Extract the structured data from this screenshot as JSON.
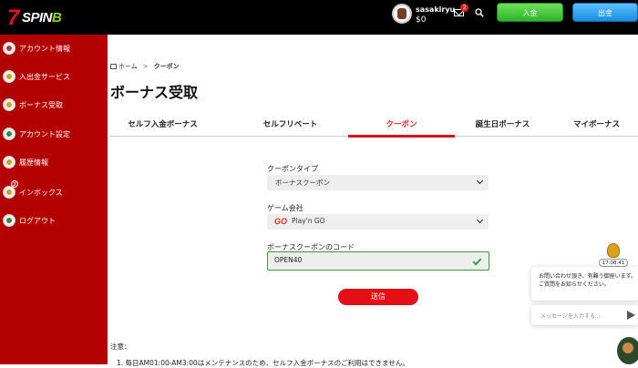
{
  "header": {
    "logo_seven": "7",
    "logo_spin": "SPIN",
    "logo_b": "B",
    "username": "sasakiryu",
    "balance": "$0",
    "mail_badge": "2",
    "deposit_label": "入金",
    "withdraw_label": "出金"
  },
  "sidebar": {
    "items": [
      {
        "label": "アカウント情報",
        "icon": "account-icon",
        "color": "#c0392b"
      },
      {
        "label": "入出金サービス",
        "icon": "wallet-icon",
        "color": "#d4a017"
      },
      {
        "label": "ボーナス受取",
        "icon": "bonus-icon",
        "color": "#d4a017"
      },
      {
        "label": "アカウント設定",
        "icon": "gear-icon",
        "color": "#3a8a3a"
      },
      {
        "label": "履歴情報",
        "icon": "history-icon",
        "color": "#d4a017"
      },
      {
        "label": "インボックス",
        "icon": "inbox-icon",
        "color": "#d4a017",
        "badge": "2"
      },
      {
        "label": "ログアウト",
        "icon": "logout-icon",
        "color": "#3a8a3a"
      }
    ]
  },
  "breadcrumb": {
    "home": "ホーム",
    "separator": ">",
    "current": "クーポン"
  },
  "page_title": "ボーナス受取",
  "tabs": [
    {
      "label": "セルフ入金ボーナス",
      "active": false
    },
    {
      "label": "セルフリベート",
      "active": false
    },
    {
      "label": "クーポン",
      "active": true
    },
    {
      "label": "誕生日ボーナス",
      "active": false
    },
    {
      "label": "マイボーナス",
      "active": false
    }
  ],
  "form": {
    "coupon_type_label": "クーポンタイプ",
    "coupon_type_value": "ボーナスクーポン",
    "game_company_label": "ゲーム会社",
    "game_company_logo": "GO",
    "game_company_value": "Play'n GO",
    "code_label": "ボーナスクーポンのコード",
    "code_value": "OPEN40",
    "submit_label": "送信"
  },
  "notes": {
    "title": "注意：",
    "line1": "1. 毎日AM01:00-AM3:00はメンテナンスのため、セルフ入金ボーナスのご利用はできません。"
  },
  "chat": {
    "time": "17:08:41",
    "message_line1": "お問い合わせ頂き、有難う御座います。",
    "message_line2": "ご質問をお知らせください。",
    "input_placeholder": "メッセージを入力する..."
  },
  "colors": {
    "sidebar_bg": "#b30000",
    "accent_red": "#e30f14",
    "deposit_green": "#2db32a",
    "withdraw_blue": "#1a8de0"
  }
}
